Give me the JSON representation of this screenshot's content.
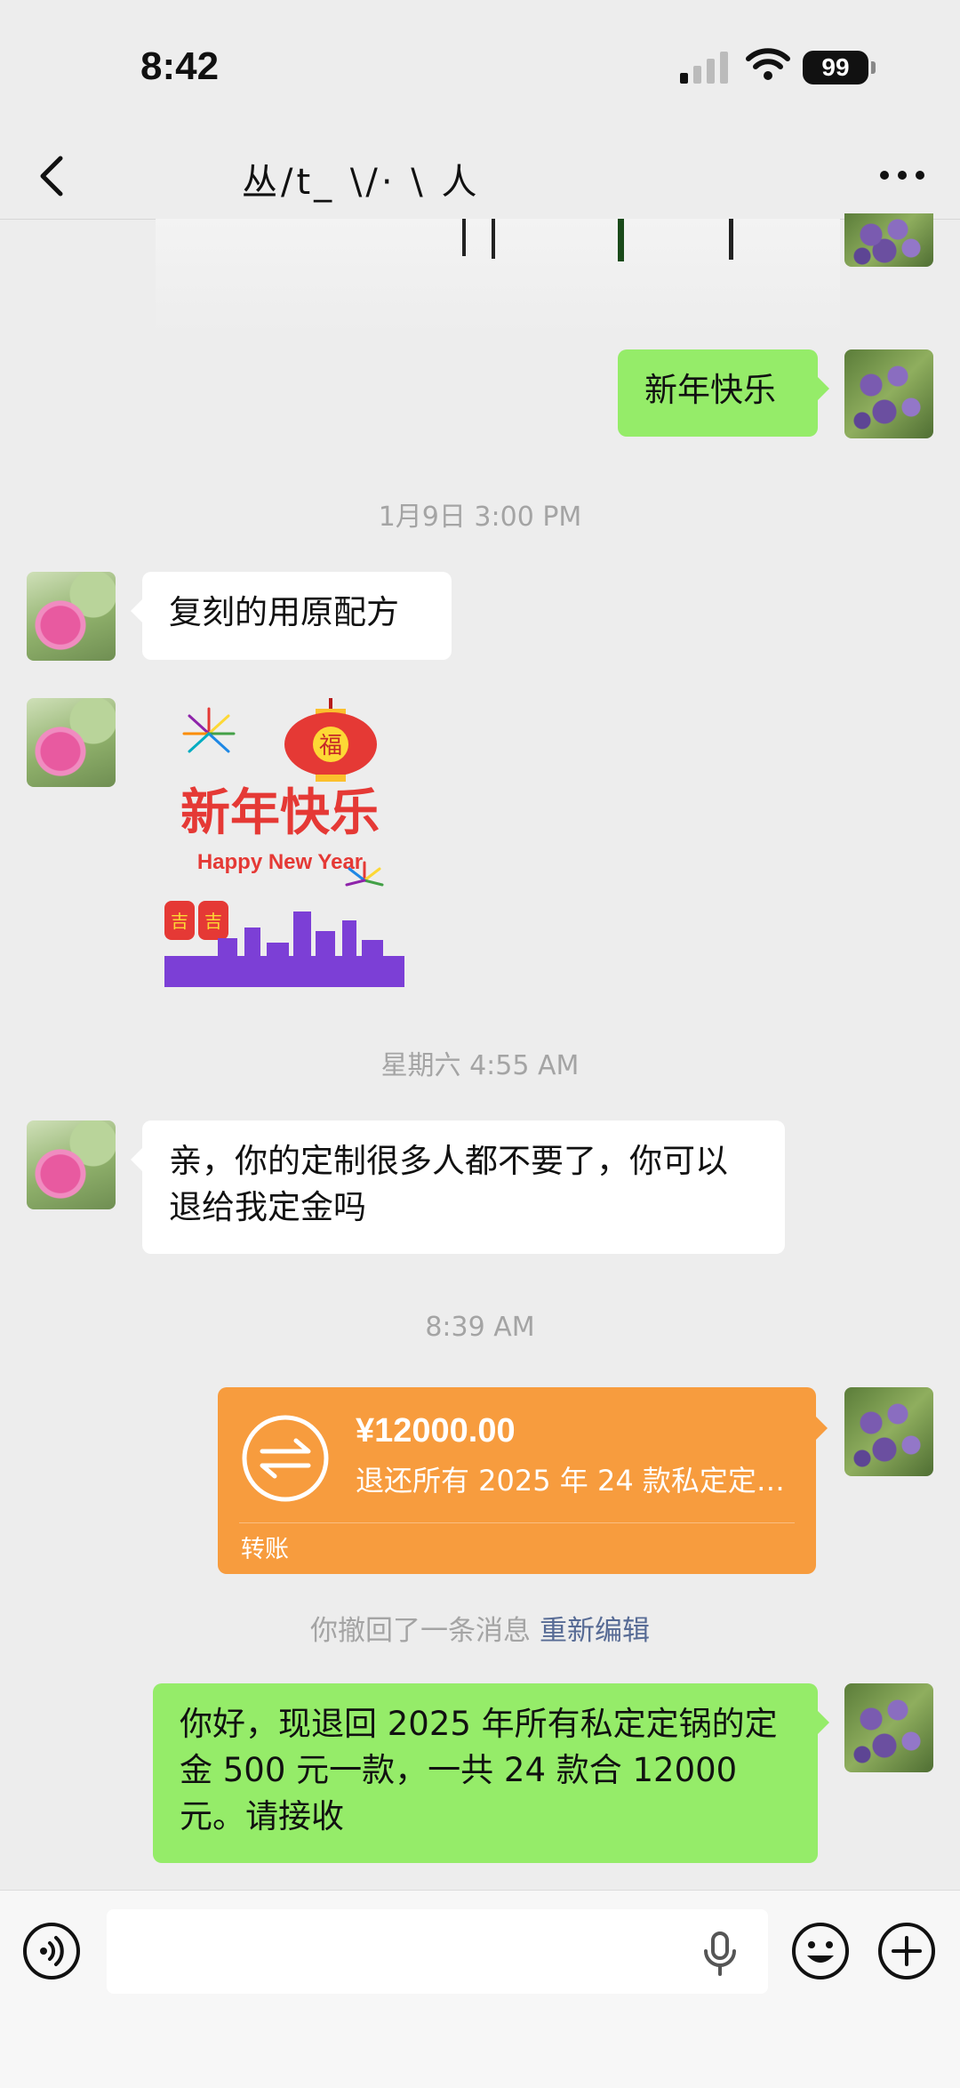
{
  "status_bar": {
    "time": "8:42",
    "battery": "99"
  },
  "nav": {
    "title": "丛/t_ \\/· \\ 人"
  },
  "messages": {
    "m1": "新年快乐",
    "ts1": "1月9日 3:00 PM",
    "m2": "复刻的用原配方",
    "sticker": {
      "title": "新年快乐",
      "subtitle": "Happy New Year",
      "lantern": "福",
      "small_lantern": "吉"
    },
    "ts2": "星期六 4:55 AM",
    "m3": "亲，你的定制很多人都不要了，你可以退给我定金吗",
    "ts3": "8:39 AM",
    "transfer": {
      "amount": "¥12000.00",
      "note": "退还所有 2025 年 24 款私定定…",
      "label": "转账"
    },
    "recall": {
      "text": "你撤回了一条消息",
      "reedit": "重新编辑"
    },
    "m4": "你好，现退回 2025 年所有私定定锅的定金 500 元一款，一共 24 款合 12000 元。请接收"
  },
  "colors": {
    "background": "#ededed",
    "green_bubble": "#95ec69",
    "transfer_orange": "#f79c3e",
    "link": "#576b95"
  }
}
